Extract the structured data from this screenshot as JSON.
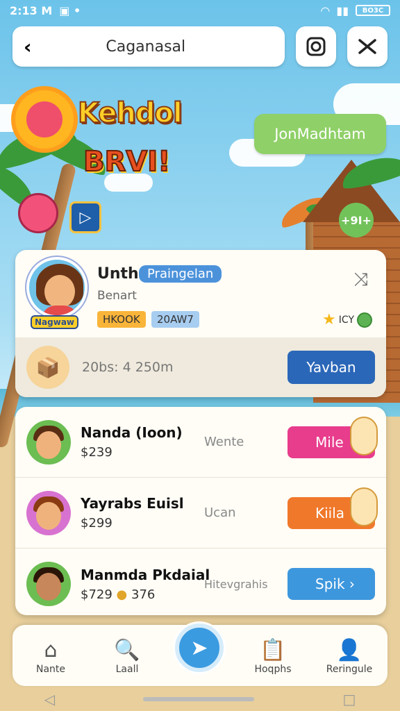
{
  "status": {
    "time": "2:13 M",
    "battery": "BO3C"
  },
  "topbar": {
    "search_text": "Caganasal"
  },
  "hero": {
    "title": "Kehdol",
    "subtitle": "BRVI!",
    "join_label": "JonMadhtam",
    "badge": "+9I+"
  },
  "profile": {
    "name": "Unth",
    "tag": "Praingelan",
    "subtitle": "Benart",
    "nametag": "Nagwaw",
    "chip1": "HKOOK",
    "chip2": "20AW7",
    "rating_text": "ICY",
    "stat": "20bs: 4 250m",
    "review_label": "Yavban"
  },
  "list": [
    {
      "name": "Nanda (Ioon)",
      "price": "$239",
      "mid": "Wente",
      "button": "Mile",
      "color": "#e83c8c"
    },
    {
      "name": "Yayrabs Euisl",
      "price": "$299",
      "mid": "Ucan",
      "button": "Kiila",
      "color": "#f0782b"
    },
    {
      "name": "Manmda Pkdaial",
      "price": "$729",
      "extra": "376",
      "mid": "Hitevgrahis",
      "button": "Spik ›",
      "color": "#3d97dd"
    }
  ],
  "nav": [
    {
      "label": "Nante",
      "icon": "home-icon"
    },
    {
      "label": "Laall",
      "icon": "search-icon"
    },
    {
      "label": "Hoqphs",
      "icon": "clipboard-icon"
    },
    {
      "label": "Reringule",
      "icon": "profile-icon"
    }
  ]
}
